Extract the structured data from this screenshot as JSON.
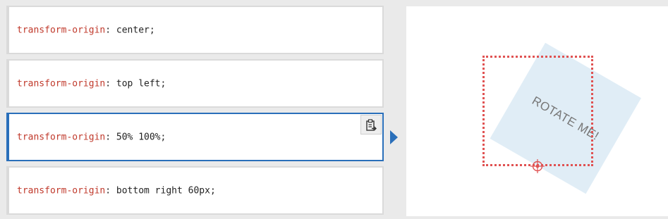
{
  "options": [
    {
      "property": "transform-origin",
      "separator": ":",
      "value": " center;"
    },
    {
      "property": "transform-origin",
      "separator": ":",
      "value": " top left;"
    },
    {
      "property": "transform-origin",
      "separator": ":",
      "value": " 50% 100%;"
    },
    {
      "property": "transform-origin",
      "separator": ":",
      "value": " bottom right 60px;"
    }
  ],
  "selected_index": 2,
  "preview": {
    "box_text": "ROTATE ME!"
  },
  "icons": {
    "copy": "clipboard-copy-icon",
    "pointer": "triangle-right-icon",
    "origin": "crosshair-icon"
  },
  "colors": {
    "property": "#c0392b",
    "selected_border": "#2a6fba",
    "origin_outline": "#e05252"
  }
}
